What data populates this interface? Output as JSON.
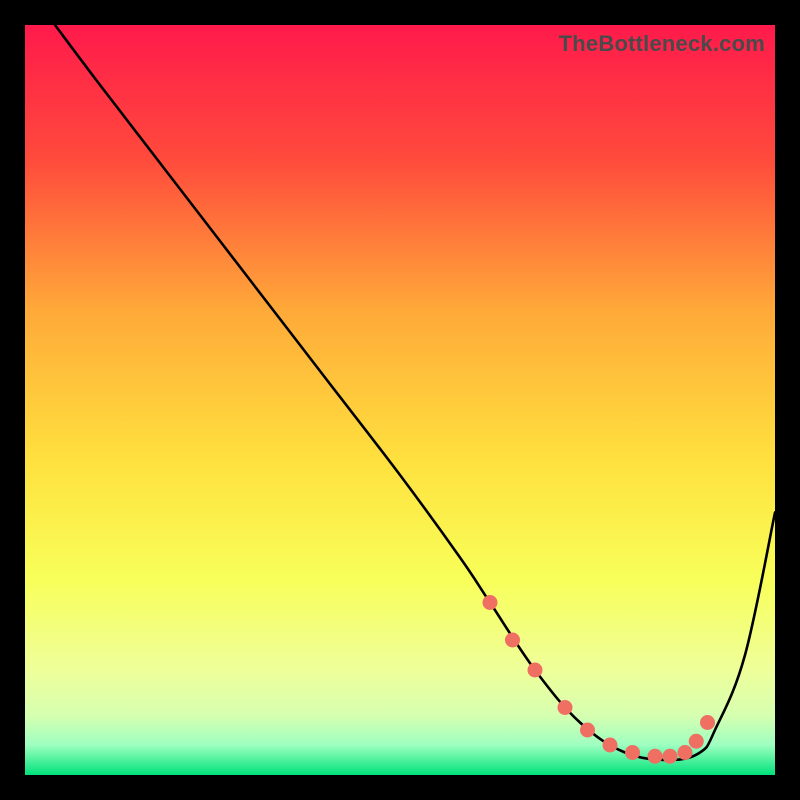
{
  "watermark": "TheBottleneck.com",
  "chart_data": {
    "type": "line",
    "title": "",
    "xlabel": "",
    "ylabel": "",
    "xlim": [
      0,
      100
    ],
    "ylim": [
      0,
      100
    ],
    "grid": false,
    "annotations": [],
    "background_gradient": {
      "top": "#ff1a4b",
      "upper_mid": "#ffa939",
      "mid": "#ffe13e",
      "lower_mid": "#f8ff5a",
      "near_bottom": "#d7ffb0",
      "bottom": "#00e27a"
    },
    "series": [
      {
        "name": "curve",
        "x": [
          4,
          10,
          20,
          30,
          40,
          50,
          58,
          62,
          68,
          74,
          80,
          86,
          90,
          92,
          96,
          100
        ],
        "y": [
          100,
          92,
          79,
          66,
          53,
          40,
          29,
          23,
          14,
          7,
          3,
          2,
          3,
          6,
          16,
          35
        ]
      }
    ],
    "markers": {
      "name": "dots",
      "color": "#ef6f63",
      "x": [
        62,
        65,
        68,
        72,
        75,
        78,
        81,
        84,
        86,
        88,
        89.5,
        91
      ],
      "y": [
        23,
        18,
        14,
        9,
        6,
        4,
        3,
        2.5,
        2.5,
        3,
        4.5,
        7
      ]
    }
  }
}
